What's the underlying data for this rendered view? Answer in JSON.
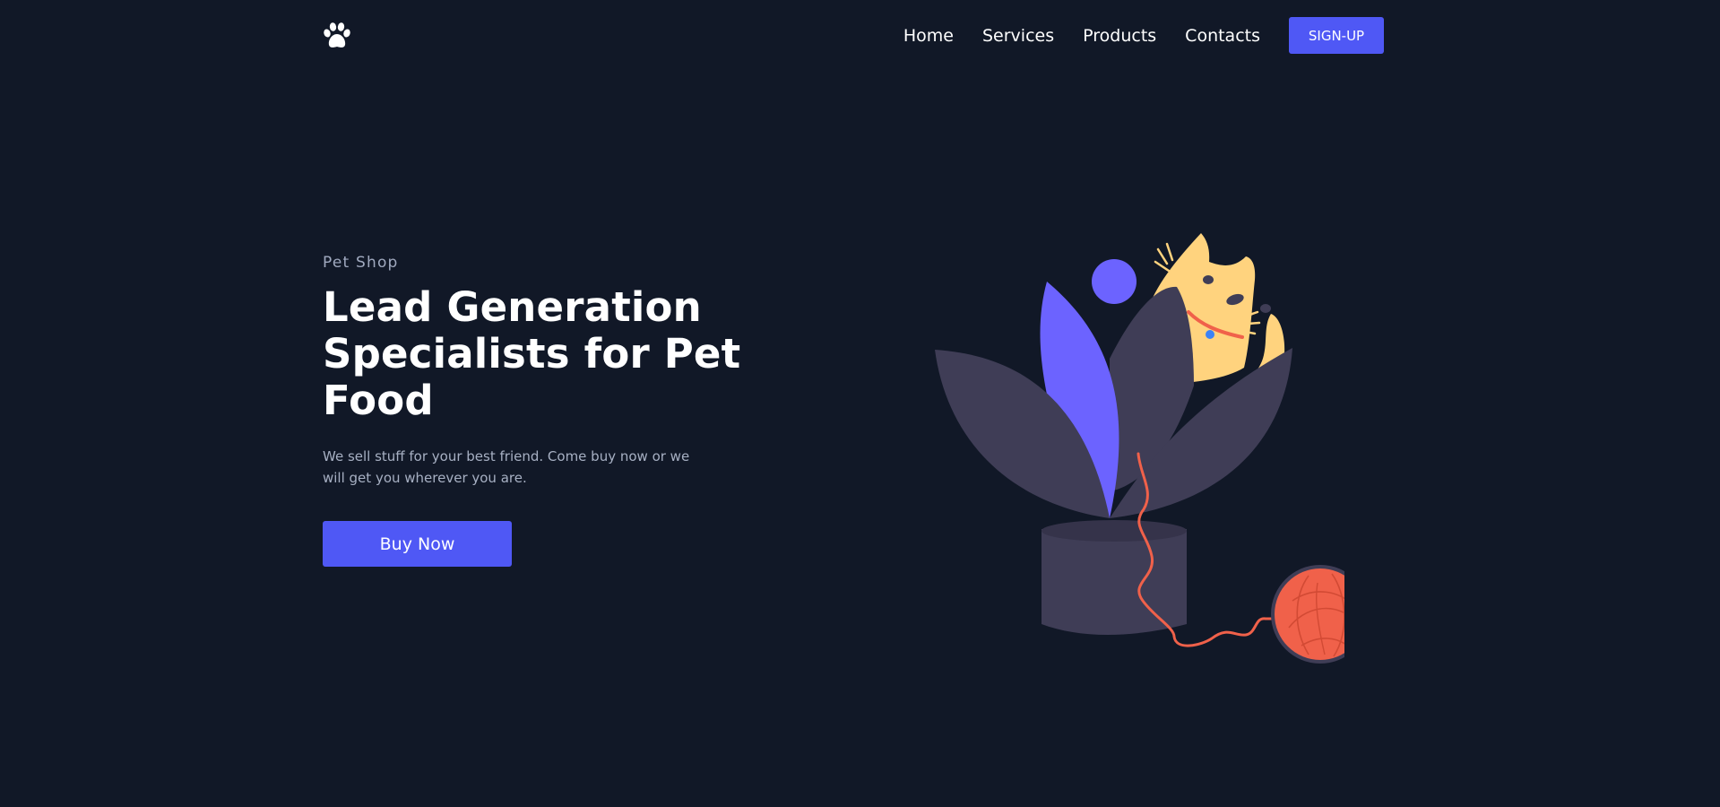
{
  "nav": {
    "logo_icon": "paw-icon",
    "links": [
      {
        "label": "Home"
      },
      {
        "label": "Services"
      },
      {
        "label": "Products"
      },
      {
        "label": "Contacts"
      }
    ],
    "signup_label": "SIGN-UP"
  },
  "hero": {
    "eyebrow": "Pet Shop",
    "title": "Lead Generation Specialists for Pet Food",
    "description": "We sell stuff for your best friend. Come buy now or we will get you wherever you are.",
    "cta_label": "Buy Now"
  },
  "illustration": {
    "name": "cat-plant-illustration",
    "colors": {
      "background": "#111827",
      "accent": "#6c63ff",
      "leaf": "#3f3d56",
      "cat": "#ffd37e",
      "yarn": "#f0614a",
      "button": "#4f58f5"
    }
  }
}
